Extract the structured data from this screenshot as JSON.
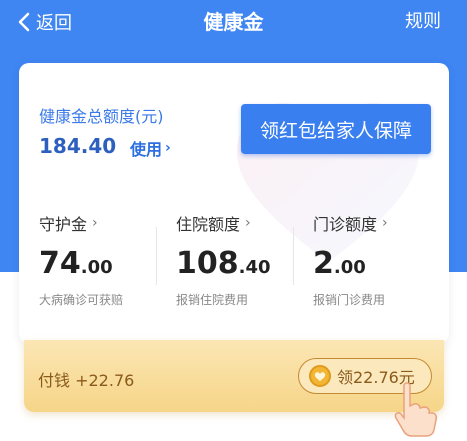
{
  "nav": {
    "back_label": "返回",
    "title": "健康金",
    "rules_label": "规则"
  },
  "summary": {
    "total_label": "健康金总额度(元)",
    "total_value": "184.40",
    "use_label": "使用",
    "cta_label": "领红包给家人保障"
  },
  "stats": [
    {
      "name": "守护金",
      "int": "74",
      "dec": ".00",
      "desc": "大病确诊可获赔"
    },
    {
      "name": "住院额度",
      "int": "108",
      "dec": ".40",
      "desc": "报销住院费用"
    },
    {
      "name": "门诊额度",
      "int": "2",
      "dec": ".00",
      "desc": "报销门诊费用"
    }
  ],
  "bonus": {
    "pay_text": "付钱 +22.76",
    "claim_label": "领22.76元"
  },
  "colors": {
    "primary": "#3f86f3",
    "cta": "#3a7ff0",
    "gold": "#f6d588"
  }
}
